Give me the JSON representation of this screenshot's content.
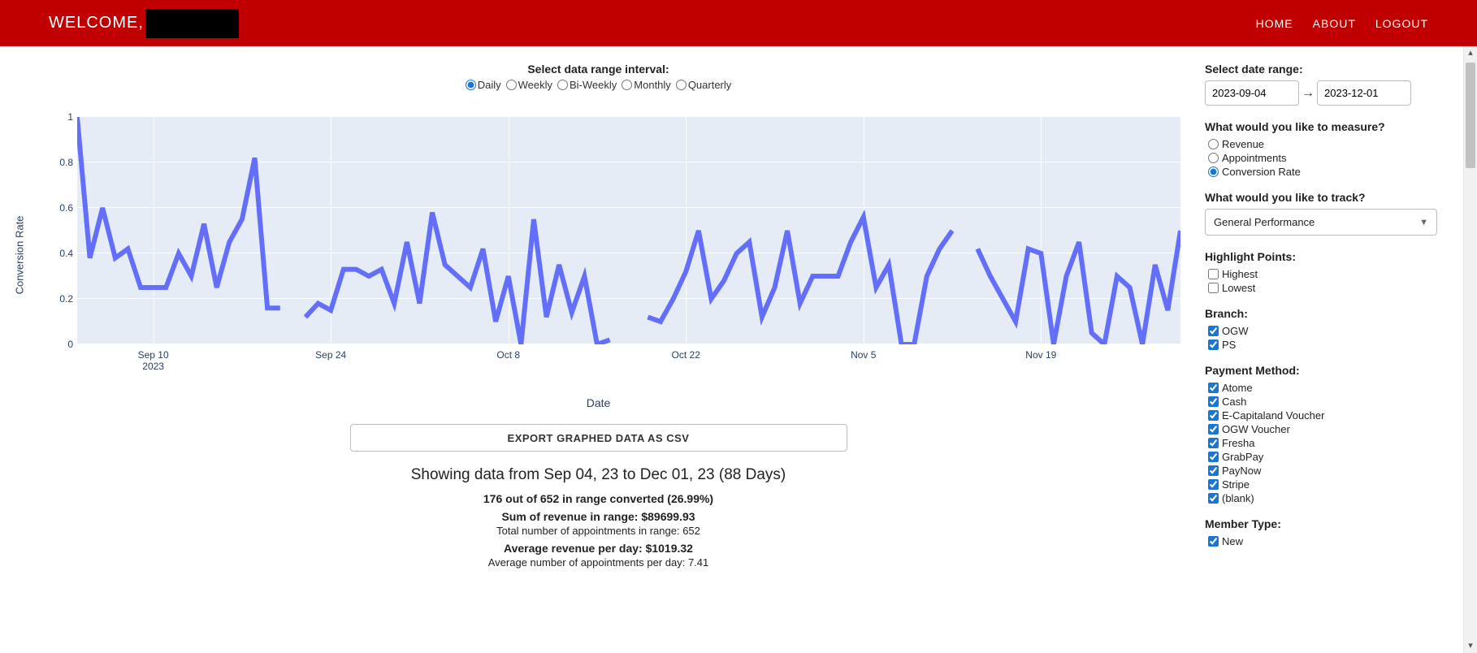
{
  "header": {
    "welcome": "WELCOME,",
    "nav": {
      "home": "HOME",
      "about": "ABOUT",
      "logout": "LOGOUT"
    }
  },
  "interval": {
    "title": "Select data range interval:",
    "options": {
      "daily": "Daily",
      "weekly": "Weekly",
      "biweekly": "Bi-Weekly",
      "monthly": "Monthly",
      "quarterly": "Quarterly"
    },
    "selected": "daily"
  },
  "chart_data": {
    "type": "line",
    "title": "",
    "xlabel": "Date",
    "ylabel": "Conversion Rate",
    "ylim": [
      0,
      1
    ],
    "yticks": [
      0,
      0.2,
      0.4,
      0.6,
      0.8,
      1
    ],
    "xticks": [
      "Sep 10\n2023",
      "Sep 24",
      "Oct 8",
      "Oct 22",
      "Nov 5",
      "Nov 19"
    ],
    "xtick_indices": [
      6,
      20,
      34,
      48,
      62,
      76
    ],
    "series": [
      {
        "name": "Conversion Rate",
        "color": "#636efa",
        "values": [
          1.0,
          0.38,
          0.6,
          0.38,
          0.42,
          0.25,
          0.25,
          0.25,
          0.4,
          0.3,
          0.53,
          0.25,
          0.45,
          0.55,
          0.82,
          0.16,
          0.16,
          null,
          0.12,
          0.18,
          0.15,
          0.33,
          0.33,
          0.3,
          0.33,
          0.18,
          0.45,
          0.18,
          0.58,
          0.35,
          0.3,
          0.25,
          0.42,
          0.1,
          0.3,
          0.0,
          0.55,
          0.12,
          0.35,
          0.14,
          0.3,
          0.0,
          0.02,
          null,
          null,
          0.12,
          0.1,
          0.2,
          0.32,
          0.5,
          0.2,
          0.28,
          0.4,
          0.45,
          0.12,
          0.25,
          0.5,
          0.18,
          0.3,
          0.3,
          0.3,
          0.45,
          0.56,
          0.25,
          0.35,
          0.0,
          0.0,
          0.3,
          0.42,
          0.5,
          null,
          0.42,
          0.3,
          0.2,
          0.1,
          0.42,
          0.4,
          0.0,
          0.3,
          0.45,
          0.05,
          0.0,
          0.3,
          0.25,
          0.0,
          0.35,
          0.15,
          0.5
        ]
      }
    ]
  },
  "export_label": "EXPORT GRAPHED DATA AS CSV",
  "stats": {
    "range": "Showing data from Sep 04, 23 to Dec 01, 23 (88 Days)",
    "converted": "176 out of 652 in range converted (26.99%)",
    "sum_rev": "Sum of revenue in range: $89699.93",
    "total_appt": "Total number of appointments in range: 652",
    "avg_rev": "Average revenue per day: $1019.32",
    "avg_appt": "Average number of appointments per day: 7.41"
  },
  "sidebar": {
    "date_label": "Select date range:",
    "date_start": "2023-09-04",
    "date_end": "2023-12-01",
    "measure_label": "What would you like to measure?",
    "measure": {
      "revenue": "Revenue",
      "appointments": "Appointments",
      "conversion": "Conversion Rate"
    },
    "track_label": "What would you like to track?",
    "track_value": "General Performance",
    "highlight_label": "Highlight Points:",
    "highlight": {
      "highest": "Highest",
      "lowest": "Lowest"
    },
    "branch_label": "Branch:",
    "branches": {
      "ogw": "OGW",
      "ps": "PS"
    },
    "payment_label": "Payment Method:",
    "payments": {
      "atome": "Atome",
      "cash": "Cash",
      "ecap": "E-Capitaland Voucher",
      "ogwv": "OGW Voucher",
      "fresha": "Fresha",
      "grabpay": "GrabPay",
      "paynow": "PayNow",
      "stripe": "Stripe",
      "blank": "(blank)"
    },
    "member_label": "Member Type:",
    "members": {
      "new": "New"
    }
  }
}
